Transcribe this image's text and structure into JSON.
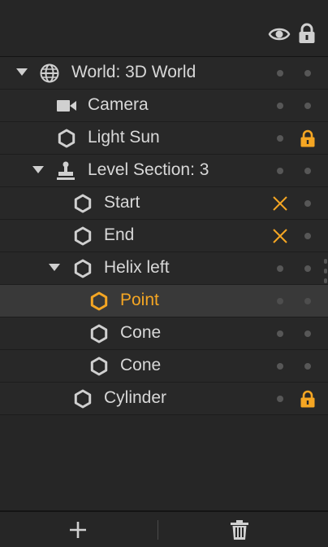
{
  "header": {
    "visibility_icon": "eye-icon",
    "lock_icon": "lock-icon"
  },
  "colors": {
    "accent": "#f5a623",
    "text": "#d8d8d8",
    "background": "#262626"
  },
  "tree": {
    "rows": [
      {
        "label": "World: 3D World",
        "icon": "globe-icon",
        "expanded": true,
        "visibility": "dot",
        "lock": "dot"
      },
      {
        "label": "Camera",
        "icon": "camera-icon",
        "visibility": "dot",
        "lock": "dot"
      },
      {
        "label": "Light Sun",
        "icon": "hexagon-icon",
        "visibility": "dot",
        "lock": "locked"
      },
      {
        "label": "Level Section: 3",
        "icon": "stamp-icon",
        "expanded": true,
        "visibility": "dot",
        "lock": "dot"
      },
      {
        "label": "Start",
        "icon": "hexagon-icon",
        "visibility": "hidden",
        "lock": "dot"
      },
      {
        "label": "End",
        "icon": "hexagon-icon",
        "visibility": "hidden",
        "lock": "dot"
      },
      {
        "label": "Helix left",
        "icon": "hexagon-icon",
        "expanded": true,
        "visibility": "dot",
        "lock": "dot"
      },
      {
        "label": "Point",
        "icon": "hexagon-icon",
        "selected": true,
        "visibility": "dot",
        "lock": "dot"
      },
      {
        "label": "Cone",
        "icon": "hexagon-icon",
        "visibility": "dot",
        "lock": "dot"
      },
      {
        "label": "Cone",
        "icon": "hexagon-icon",
        "visibility": "dot",
        "lock": "dot"
      },
      {
        "label": "Cylinder",
        "icon": "hexagon-icon",
        "visibility": "dot",
        "lock": "locked"
      }
    ]
  },
  "footer": {
    "add_icon": "plus-icon",
    "delete_icon": "trash-icon"
  }
}
